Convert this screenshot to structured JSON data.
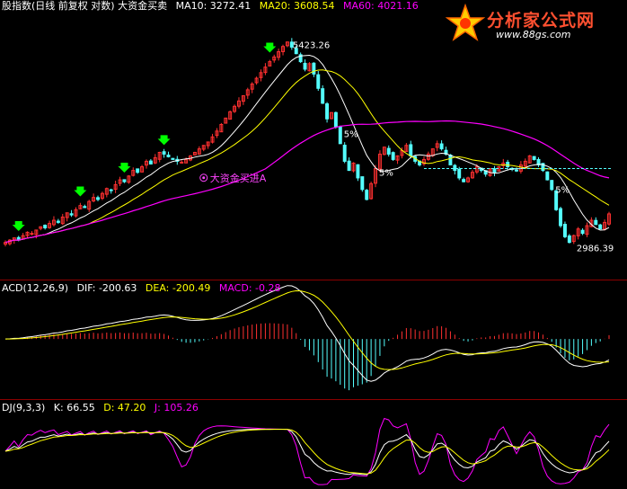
{
  "colors": {
    "background": "#000000",
    "up": "#ff3030",
    "down": "#54ffff",
    "ma10": "#ffffff",
    "ma20": "#ffff00",
    "ma60": "#ff00ff",
    "signal": "#ff44ff",
    "buy_arrow": "#00ff00",
    "separator": "#8a0000"
  },
  "main_panel": {
    "header": {
      "title": "股指数(日线 前复权 对数) 大资金买卖",
      "ma10": "MA10: 3272.41",
      "ma20": "MA20: 3608.54",
      "ma60": "MA60: 4021.16"
    },
    "annotations": {
      "high_label": "5423.26",
      "low_label": "2986.39",
      "signal_label": "大资金买进A",
      "pct_labels": [
        "5%",
        "5%",
        "5%"
      ]
    }
  },
  "macd_panel": {
    "header": {
      "name": "ACD(12,26,9)",
      "dif": "DIF: -200.63",
      "dea": "DEA: -200.49",
      "macd": "MACD: -0.28"
    }
  },
  "kdj_panel": {
    "header": {
      "name": "DJ(9,3,3)",
      "k": "K: 66.55",
      "d": "D: 47.20",
      "j": "J: 105.26"
    }
  },
  "logo": {
    "text": "分析家公式网",
    "url": "www.88gs.com"
  },
  "chart_data": [
    {
      "type": "candlestick",
      "panel": "main",
      "scale": "log",
      "ylim": [
        2800,
        5800
      ],
      "high": 5423.26,
      "low": 2986.39,
      "close": [
        3000,
        3020,
        3040,
        3020,
        3060,
        3090,
        3080,
        3110,
        3140,
        3130,
        3170,
        3200,
        3180,
        3230,
        3270,
        3250,
        3300,
        3340,
        3320,
        3380,
        3420,
        3400,
        3460,
        3510,
        3490,
        3550,
        3600,
        3580,
        3640,
        3700,
        3680,
        3740,
        3800,
        3770,
        3840,
        3900,
        3880,
        3850,
        3820,
        3800,
        3790,
        3820,
        3860,
        3900,
        3940,
        3980,
        4020,
        4080,
        4150,
        4230,
        4310,
        4390,
        4460,
        4530,
        4600,
        4680,
        4760,
        4840,
        4920,
        5000,
        5080,
        5150,
        5230,
        5310,
        5380,
        5300,
        5200,
        5080,
        4970,
        5050,
        4900,
        4700,
        4500,
        4300,
        4380,
        4200,
        4000,
        3800,
        3700,
        3780,
        3620,
        3500,
        3400,
        3560,
        3720,
        3880,
        3960,
        3880,
        3820,
        3860,
        3920,
        3980,
        3860,
        3800,
        3760,
        3820,
        3880,
        3940,
        4000,
        3940,
        3880,
        3760,
        3700,
        3620,
        3580,
        3620,
        3680,
        3740,
        3700,
        3660,
        3720,
        3680,
        3740,
        3780,
        3740,
        3720,
        3700,
        3760,
        3800,
        3860,
        3820,
        3760,
        3700,
        3600,
        3500,
        3300,
        3150,
        3050,
        3000,
        3060,
        3120,
        3080,
        3150,
        3200,
        3160,
        3120,
        3180,
        3260
      ],
      "series": [
        {
          "name": "MA10",
          "values": [
            3272.41
          ]
        },
        {
          "name": "MA20",
          "values": [
            3608.54
          ]
        },
        {
          "name": "MA60",
          "values": [
            4021.16
          ]
        }
      ]
    },
    {
      "type": "bar",
      "panel": "macd",
      "ylim": [
        -400,
        300
      ],
      "series": [
        {
          "name": "DIF",
          "values": [
            -200.63
          ]
        },
        {
          "name": "DEA",
          "values": [
            -200.49
          ]
        },
        {
          "name": "MACD",
          "values": [
            -0.28
          ]
        }
      ]
    },
    {
      "type": "line",
      "panel": "kdj",
      "ylim": [
        -20,
        120
      ],
      "series": [
        {
          "name": "K",
          "values": [
            66.55
          ]
        },
        {
          "name": "D",
          "values": [
            47.2
          ]
        },
        {
          "name": "J",
          "values": [
            105.26
          ]
        }
      ]
    }
  ]
}
